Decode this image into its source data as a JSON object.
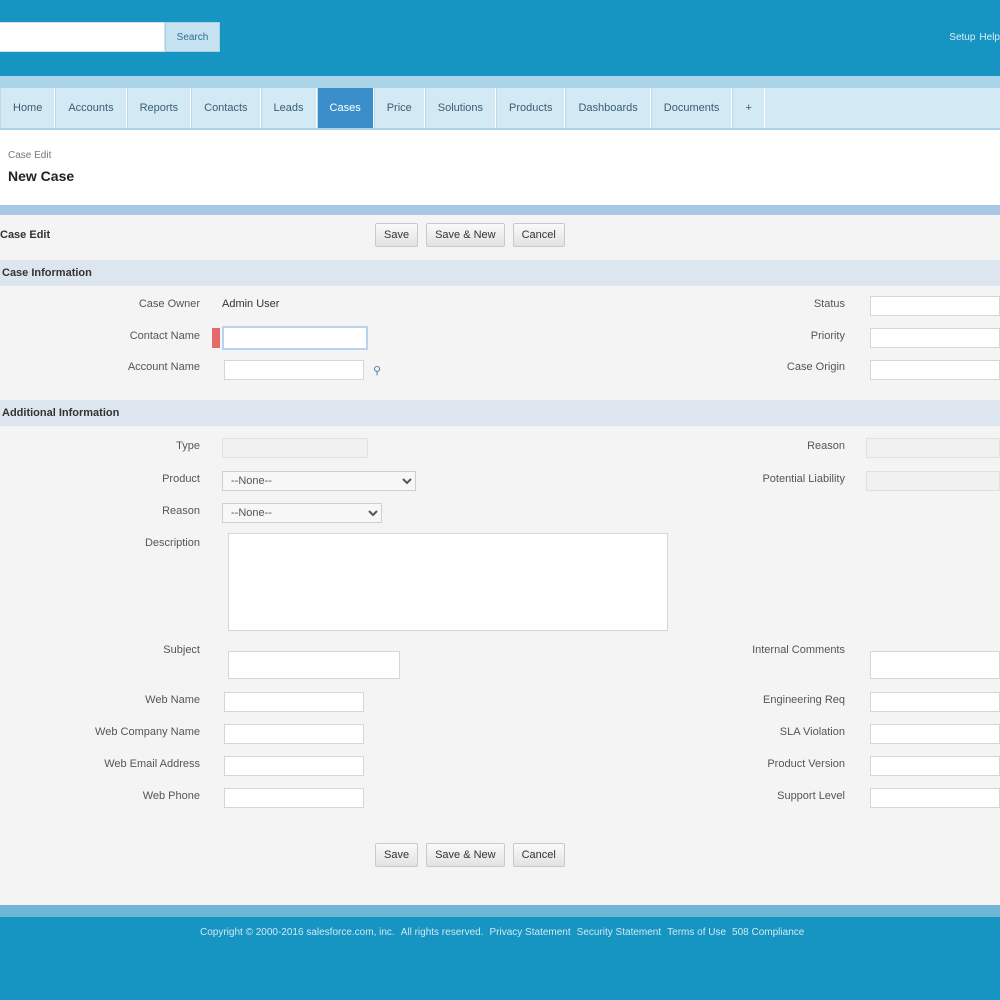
{
  "header": {
    "search_value": "",
    "search_button": "Search",
    "links": [
      "Setup",
      "Help"
    ]
  },
  "tabs": [
    {
      "label": "Home",
      "active": false
    },
    {
      "label": "Accounts",
      "active": false
    },
    {
      "label": "Reports",
      "active": false
    },
    {
      "label": "Contacts",
      "active": false
    },
    {
      "label": "Leads",
      "active": false
    },
    {
      "label": "Cases",
      "active": true
    },
    {
      "label": "Price",
      "active": false
    },
    {
      "label": "Solutions",
      "active": false
    },
    {
      "label": "Products",
      "active": false
    },
    {
      "label": "Dashboards",
      "active": false
    },
    {
      "label": "Documents",
      "active": false
    },
    {
      "label": "+",
      "active": false
    }
  ],
  "page": {
    "breadcrumb": "Case Edit",
    "title": "New Case"
  },
  "top_bar": {
    "title": "Case Edit",
    "buttons": [
      "Save",
      "Save & New",
      "Cancel"
    ]
  },
  "section1": {
    "title": "Case Information",
    "left": [
      {
        "label": "Case Owner",
        "value": "Admin User"
      },
      {
        "label": "Contact Name",
        "value": ""
      },
      {
        "label": "Account Name",
        "value": ""
      }
    ],
    "right": [
      {
        "label": "Status",
        "value": ""
      },
      {
        "label": "Priority",
        "value": ""
      },
      {
        "label": "Case Origin",
        "value": ""
      }
    ]
  },
  "section2": {
    "title": "Additional Information",
    "row1_left_label": "Type",
    "row1_right_label": "Reason",
    "type_label": "Product",
    "type_select": "--None--",
    "right_row2_label": "Potential Liability",
    "reason_label": "Reason",
    "reason_select": "--None--",
    "description_label": "Description",
    "subject_label": "Subject",
    "right_subject_label": "Internal Comments",
    "extra_left": [
      "Web Name",
      "Web Company Name",
      "Web Email Address",
      "Web Phone"
    ],
    "extra_right": [
      "Engineering Req",
      "SLA Violation",
      "Product Version",
      "Support Level"
    ]
  },
  "bottom_bar": {
    "buttons": [
      "Save",
      "Save & New",
      "Cancel"
    ]
  },
  "footer": {
    "links": [
      "Copyright © 2000-2016 salesforce.com, inc.",
      "All rights reserved.",
      "Privacy Statement",
      "Security Statement",
      "Terms of Use",
      "508 Compliance"
    ]
  }
}
